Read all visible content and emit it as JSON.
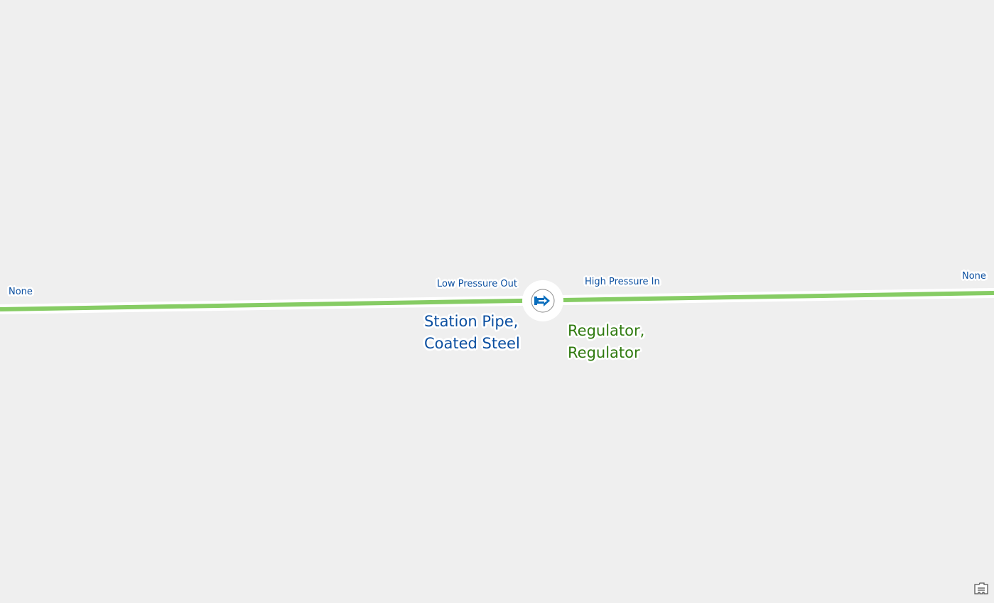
{
  "map": {
    "background_color": "#efefef",
    "pipe_line_color": "#86cc64",
    "pipe_casing_color": "#ffffff",
    "device_symbol_color": "#0a6ebd"
  },
  "labels": {
    "left_end": "None",
    "right_end": "None",
    "low_pressure": "Low Pressure Out",
    "high_pressure": "High Pressure In",
    "pipe_line1": "Station Pipe,",
    "pipe_line2": "Coated Steel",
    "regulator_line1": "Regulator,",
    "regulator_line2": "Regulator"
  },
  "colors": {
    "label_blue": "#0b4fa0",
    "label_green": "#2f7a0f"
  },
  "controls": {
    "legend_icon": "legend-icon"
  }
}
